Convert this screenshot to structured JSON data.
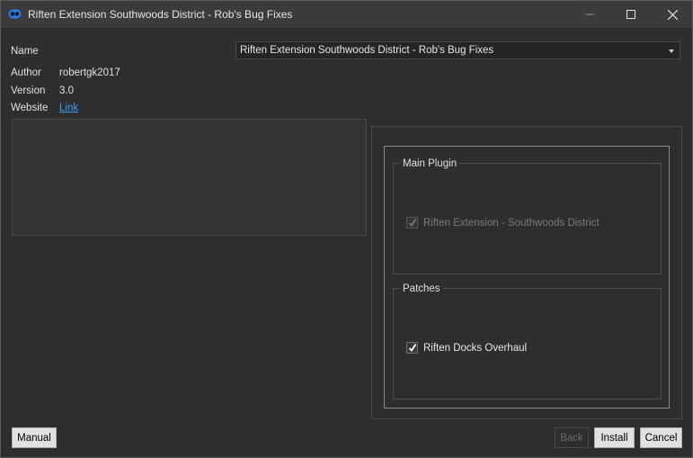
{
  "window": {
    "title": "Riften Extension Southwoods District - Rob's Bug Fixes",
    "app_icon": "mod-organizer-icon"
  },
  "info": {
    "name_label": "Name",
    "name_value": "Riften Extension Southwoods District - Rob's Bug Fixes",
    "author_label": "Author",
    "author_value": "robertgk2017",
    "version_label": "Version",
    "version_value": "3.0",
    "website_label": "Website",
    "website_link": "Link"
  },
  "groups": {
    "main_plugin": {
      "title": "Main Plugin",
      "options": [
        {
          "label": "Riften Extension - Southwoods District",
          "checked": true,
          "disabled": true
        }
      ]
    },
    "patches": {
      "title": "Patches",
      "options": [
        {
          "label": "Riften Docks Overhaul",
          "checked": true,
          "disabled": false
        }
      ]
    }
  },
  "buttons": {
    "manual": "Manual",
    "back": "Back",
    "install": "Install",
    "cancel": "Cancel"
  },
  "colors": {
    "background": "#2e2e30",
    "link": "#3a9df0",
    "accent_icon": "#2f7fe0"
  }
}
